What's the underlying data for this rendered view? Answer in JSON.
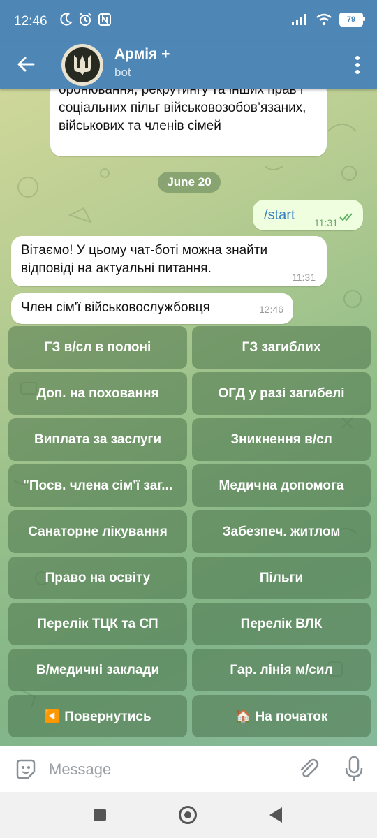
{
  "status_bar": {
    "time": "12:46",
    "battery": "79"
  },
  "header": {
    "title": "Армія +",
    "subtitle": "bot"
  },
  "messages": {
    "cut_off_text": "оронювання, рекрутингу та інших прав і соціальних пільг військовозобов’язаних, військових та членів сімей",
    "date_separator": "June 20",
    "outgoing": {
      "text": "/start",
      "time": "11:31"
    },
    "incoming_1": {
      "text": "Вітаємо! У цьому чат-боті можна знайти відповіді на актуальні питання.",
      "time": "11:31"
    },
    "incoming_2": {
      "text": "Член сім'ї військовослужбовця",
      "time": "12:46"
    }
  },
  "keyboard": {
    "buttons": [
      "ГЗ в/сл в полоні",
      "ГЗ загиблих",
      "Доп. на поховання",
      "ОГД у разі загибелі",
      "Виплата за заслуги",
      "Зникнення в/сл",
      "\"Посв. члена сім'ї заг...",
      "Медична допомога",
      "Санаторне лікування",
      "Забезпеч. житлом",
      "Право на освіту",
      "Пільги",
      "Перелік ТЦК та СП",
      "Перелік ВЛК",
      "В/медичні заклади",
      "Гар. лінія м/сил",
      "◀️ Повернутись",
      "🏠 На початок"
    ]
  },
  "composer": {
    "placeholder": "Message"
  },
  "colors": {
    "header": "#4e86b6",
    "keyboard_button": "#5a7f5a",
    "outgoing_bubble": "#eefedf"
  },
  "icons": [
    "moon-icon",
    "alarm-icon",
    "nfc-icon",
    "signal-icon",
    "wifi-icon",
    "battery-icon",
    "back-arrow-icon",
    "more-vert-icon",
    "sticker-icon",
    "paperclip-icon",
    "mic-icon"
  ]
}
